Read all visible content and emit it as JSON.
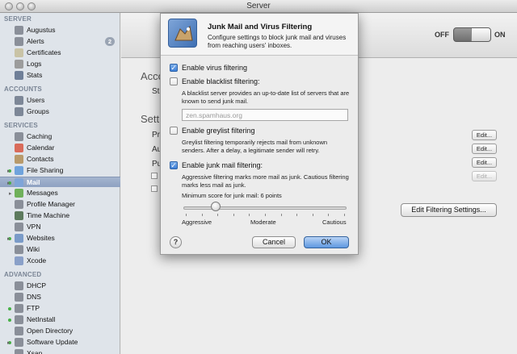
{
  "window": {
    "title": "Server"
  },
  "sidebar": {
    "sections": [
      {
        "header": "SERVER",
        "items": [
          {
            "label": "Augustus",
            "icon": "server-icon",
            "color": "#8a8f99"
          },
          {
            "label": "Alerts",
            "icon": "alerts-icon",
            "badge": "2",
            "color": "#8a8f99"
          },
          {
            "label": "Certificates",
            "icon": "certificate-icon",
            "color": "#c9c3a6"
          },
          {
            "label": "Logs",
            "icon": "log-icon",
            "color": "#9c9c9c"
          },
          {
            "label": "Stats",
            "icon": "stats-icon",
            "color": "#6f7f98"
          }
        ]
      },
      {
        "header": "ACCOUNTS",
        "items": [
          {
            "label": "Users",
            "icon": "user-icon",
            "color": "#7d8797"
          },
          {
            "label": "Groups",
            "icon": "group-icon",
            "color": "#7d8797"
          }
        ]
      },
      {
        "header": "SERVICES",
        "items": [
          {
            "label": "Caching",
            "icon": "caching-icon",
            "color": "#8a8f99"
          },
          {
            "label": "Calendar",
            "icon": "calendar-icon",
            "color": "#d96b5a"
          },
          {
            "label": "Contacts",
            "icon": "contacts-icon",
            "color": "#b89a6b"
          },
          {
            "label": "File Sharing",
            "icon": "folder-icon",
            "color": "#6fa3dc",
            "status": "on",
            "disclosure": true
          },
          {
            "label": "Mail",
            "icon": "mail-icon",
            "color": "#7fa5d8",
            "status": "on",
            "disclosure": true,
            "selected": true
          },
          {
            "label": "Messages",
            "icon": "messages-icon",
            "color": "#6fb05a",
            "disclosure": true
          },
          {
            "label": "Profile Manager",
            "icon": "profile-manager-icon",
            "color": "#8a8f99"
          },
          {
            "label": "Time Machine",
            "icon": "time-machine-icon",
            "color": "#5d7a5d"
          },
          {
            "label": "VPN",
            "icon": "vpn-icon",
            "color": "#8a8f99"
          },
          {
            "label": "Websites",
            "icon": "globe-icon",
            "color": "#7a9bc8",
            "status": "on",
            "disclosure": true
          },
          {
            "label": "Wiki",
            "icon": "wiki-icon",
            "color": "#8a8f99"
          },
          {
            "label": "Xcode",
            "icon": "xcode-icon",
            "color": "#8aa0c8"
          }
        ]
      },
      {
        "header": "ADVANCED",
        "items": [
          {
            "label": "DHCP",
            "icon": "dhcp-icon",
            "color": "#8a8f99"
          },
          {
            "label": "DNS",
            "icon": "dns-icon",
            "color": "#8a8f99"
          },
          {
            "label": "FTP",
            "icon": "ftp-icon",
            "color": "#8a8f99",
            "status": "on"
          },
          {
            "label": "NetInstall",
            "icon": "netinstall-icon",
            "color": "#8a8f99",
            "status": "on"
          },
          {
            "label": "Open Directory",
            "icon": "open-directory-icon",
            "color": "#8a8f99"
          },
          {
            "label": "Software Update",
            "icon": "software-update-icon",
            "color": "#8a8f99",
            "status": "on",
            "disclosure": true
          },
          {
            "label": "Xsan",
            "icon": "xsan-icon",
            "color": "#8a8f99"
          }
        ]
      }
    ]
  },
  "main": {
    "toggle": {
      "off_label": "OFF",
      "on_label": "ON"
    },
    "background": {
      "heading1": "Acco",
      "status_label": "St",
      "heading2": "Setti",
      "row1": "Pr",
      "row2": "Au",
      "row3": "Pu",
      "edit_label": "Edit...",
      "filtering_button": "Edit Filtering Settings..."
    }
  },
  "sheet": {
    "title": "Junk Mail and Virus Filtering",
    "subtitle": "Configure settings to block junk mail and viruses from reaching users' inboxes.",
    "virus": {
      "label": "Enable virus filtering",
      "checked": true
    },
    "blacklist": {
      "label": "Enable blacklist filtering:",
      "checked": false,
      "description": "A blacklist server provides an up-to-date list of servers that are known to send junk mail.",
      "placeholder": "zen.spamhaus.org"
    },
    "greylist": {
      "label": "Enable greylist filtering",
      "checked": false,
      "description": "Greylist filtering temporarily rejects mail from unknown senders. After a delay, a legitimate sender will retry."
    },
    "junk": {
      "label": "Enable junk mail filtering:",
      "checked": true,
      "description": "Aggressive filtering marks more mail as junk. Cautious filtering marks less mail as junk.",
      "score_text": "Minimum score for junk mail:  6 points",
      "slider_position": 0.18,
      "tick_count": 11,
      "aggressive": "Aggressive",
      "moderate": "Moderate",
      "cautious": "Cautious"
    },
    "help_label": "?",
    "cancel_label": "Cancel",
    "ok_label": "OK"
  }
}
